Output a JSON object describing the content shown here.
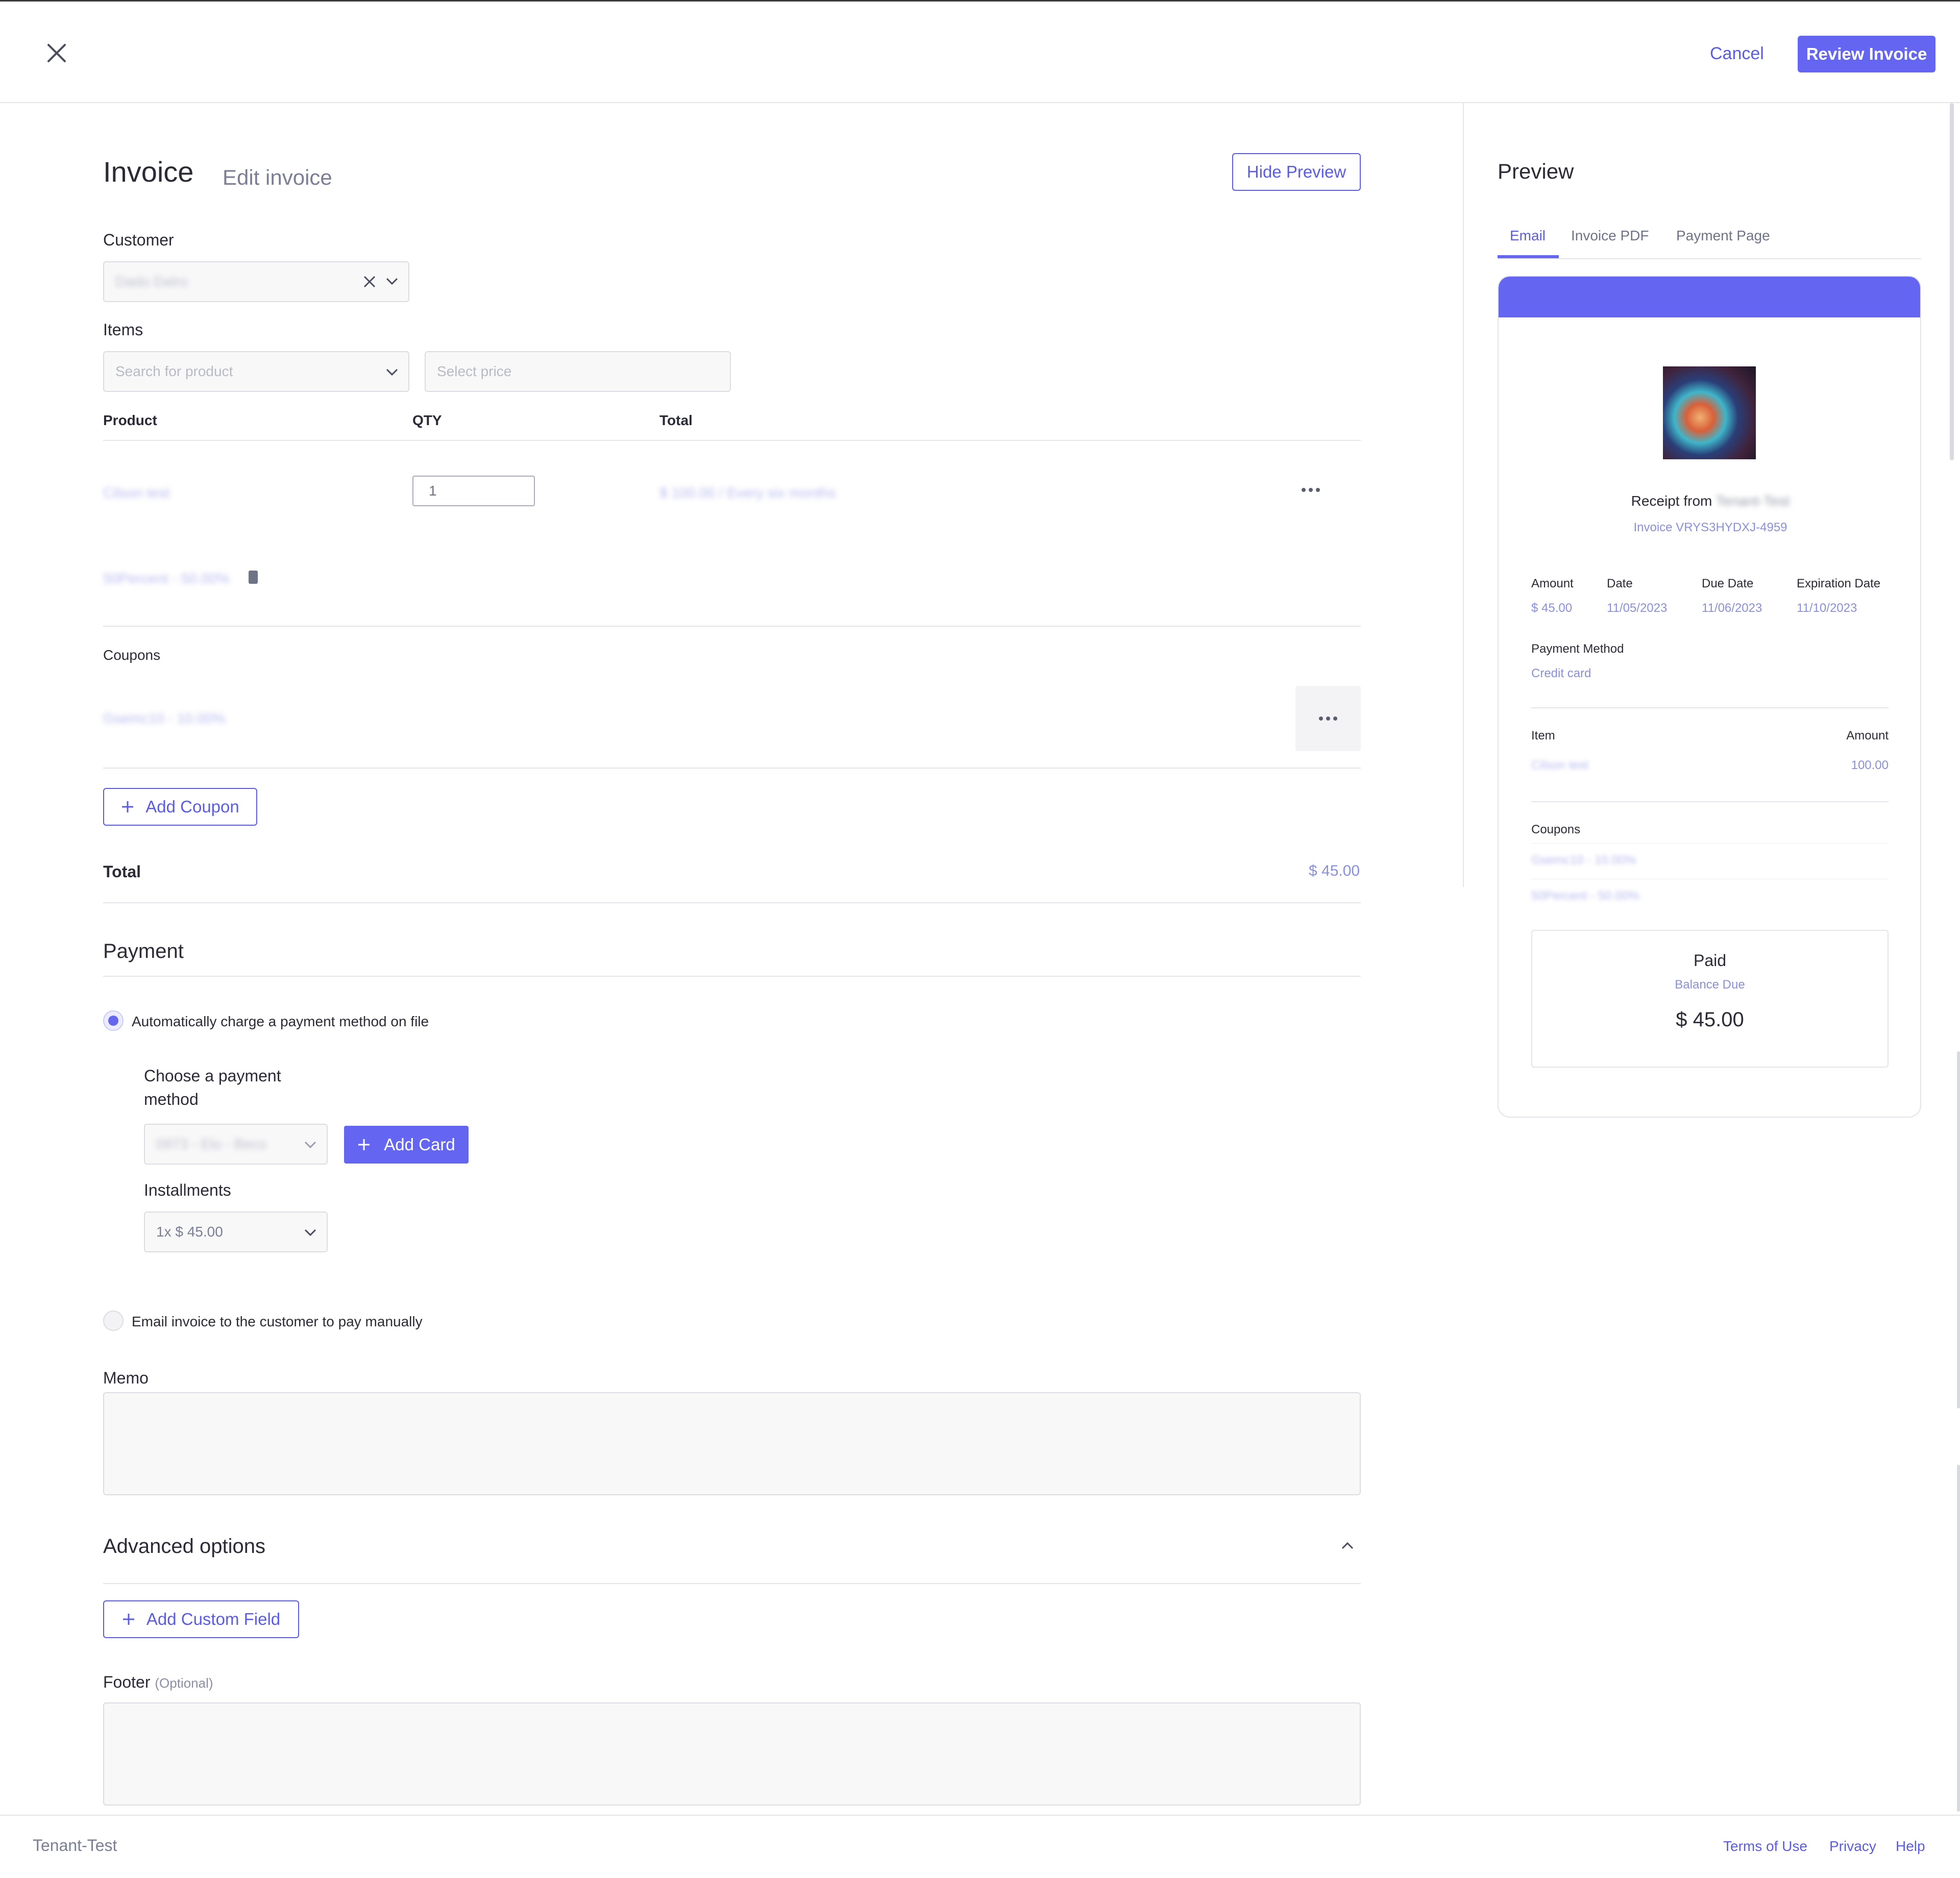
{
  "topbar": {
    "cancel_label": "Cancel",
    "review_label": "Review Invoice"
  },
  "header": {
    "title": "Invoice",
    "subtitle": "Edit invoice",
    "hide_preview_label": "Hide Preview"
  },
  "customer": {
    "label": "Customer",
    "value": "Dado Dalro"
  },
  "items": {
    "label": "Items",
    "product_placeholder": "Search for product",
    "price_placeholder": "Select price",
    "columns": [
      "Product",
      "QTY",
      "Total"
    ],
    "rows": [
      {
        "product": "Cilson test",
        "qty": "1",
        "total": "$ 100.00 / Every six months"
      }
    ],
    "discount": "50Percent - 50.00%"
  },
  "coupons": {
    "label": "Coupons",
    "item": "Gsemc10 - 10.00%",
    "add_label": "Add Coupon"
  },
  "total": {
    "label": "Total",
    "value": "$ 45.00"
  },
  "payment": {
    "title": "Payment",
    "auto_label": "Automatically charge a payment method on file",
    "choose_label_line1": "Choose a payment",
    "choose_label_line2": "method",
    "card_value": "0973 - Elo - Beco",
    "add_card_label": "Add Card",
    "installments_label": "Installments",
    "installments_value": "1x $ 45.00",
    "manual_label": "Email invoice to the customer to pay manually"
  },
  "memo": {
    "label": "Memo"
  },
  "advanced": {
    "title": "Advanced options",
    "add_field_label": "Add Custom Field"
  },
  "footer_field": {
    "label": "Footer",
    "optional": "(Optional)"
  },
  "preview": {
    "title": "Preview",
    "tabs": [
      "Email",
      "Invoice PDF",
      "Payment Page"
    ],
    "receipt_from": "Receipt from",
    "tenant_name": "Tenant-Test",
    "invoice_number": "Invoice VRYS3HYDXJ-4959",
    "amount_label": "Amount",
    "amount_value": "$ 45.00",
    "date_label": "Date",
    "date_value": "11/05/2023",
    "due_label": "Due Date",
    "due_value": "11/06/2023",
    "expiration_label": "Expiration Date",
    "expiration_value": "11/10/2023",
    "method_label": "Payment Method",
    "method_value": "Credit card",
    "item_header": "Item",
    "amount_header": "Amount",
    "item_name": "Cilson test",
    "item_amount": "100.00",
    "coupons_label": "Coupons",
    "coupon_1": "Gsemc10 - 10.00%",
    "coupon_2": "50Percent - 50.00%",
    "paid_label": "Paid",
    "balance_label": "Balance Due",
    "balance_value": "$ 45.00"
  },
  "footer": {
    "brand": "Tenant-Test",
    "links": [
      "Terms of Use",
      "Privacy",
      "Help"
    ]
  },
  "colors": {
    "accent": "#6466f1",
    "accent_text": "#5b5ce2",
    "border": "#e4e5ea"
  }
}
